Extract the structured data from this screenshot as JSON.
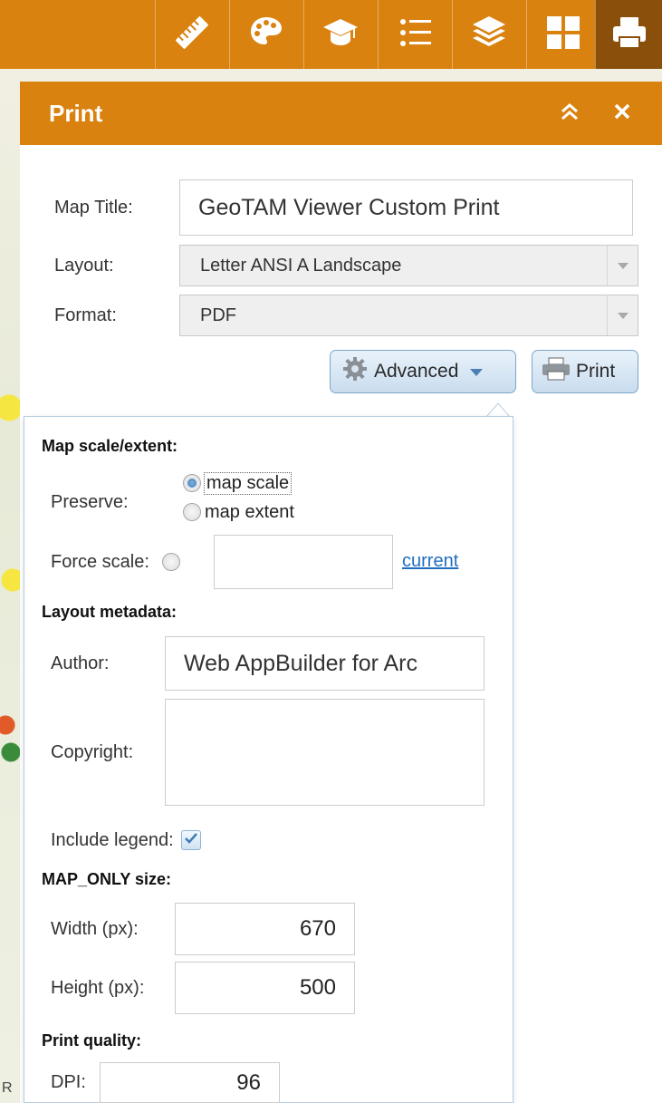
{
  "toolbar": {
    "tools": [
      {
        "icon": "ruler-icon"
      },
      {
        "icon": "palette-icon"
      },
      {
        "icon": "graduation-cap-icon"
      },
      {
        "icon": "legend-list-icon"
      },
      {
        "icon": "layers-icon"
      },
      {
        "icon": "widget-grid-icon"
      },
      {
        "icon": "printer-icon",
        "active": true
      }
    ],
    "color": "#d9820f",
    "active_color": "#8a4f0b"
  },
  "map": {
    "corner_letter": "R"
  },
  "panel": {
    "title": "Print",
    "collapse_icon": "double-chevron-up-icon",
    "close_icon": "close-icon"
  },
  "form": {
    "map_title_label": "Map Title:",
    "map_title_value": "GeoTAM Viewer Custom Print",
    "layout_label": "Layout:",
    "layout_value": "Letter ANSI A Landscape",
    "format_label": "Format:",
    "format_value": "PDF",
    "advanced_label": "Advanced",
    "print_label": "Print"
  },
  "advanced": {
    "scale_section": "Map scale/extent:",
    "preserve_label": "Preserve:",
    "opt_scale": "map scale",
    "opt_extent": "map extent",
    "preserve_selected": "map scale",
    "force_scale_label": "Force scale:",
    "force_scale_value": "",
    "current_link": "current",
    "metadata_section": "Layout metadata:",
    "author_label": "Author:",
    "author_value": "Web AppBuilder for Arc",
    "copyright_label": "Copyright:",
    "copyright_value": "",
    "legend_label": "Include legend:",
    "legend_checked": true,
    "maponly_section": "MAP_ONLY size:",
    "width_label": "Width (px):",
    "width_value": "670",
    "height_label": "Height (px):",
    "height_value": "500",
    "quality_section": "Print quality:",
    "dpi_label": "DPI:",
    "dpi_value": "96"
  }
}
